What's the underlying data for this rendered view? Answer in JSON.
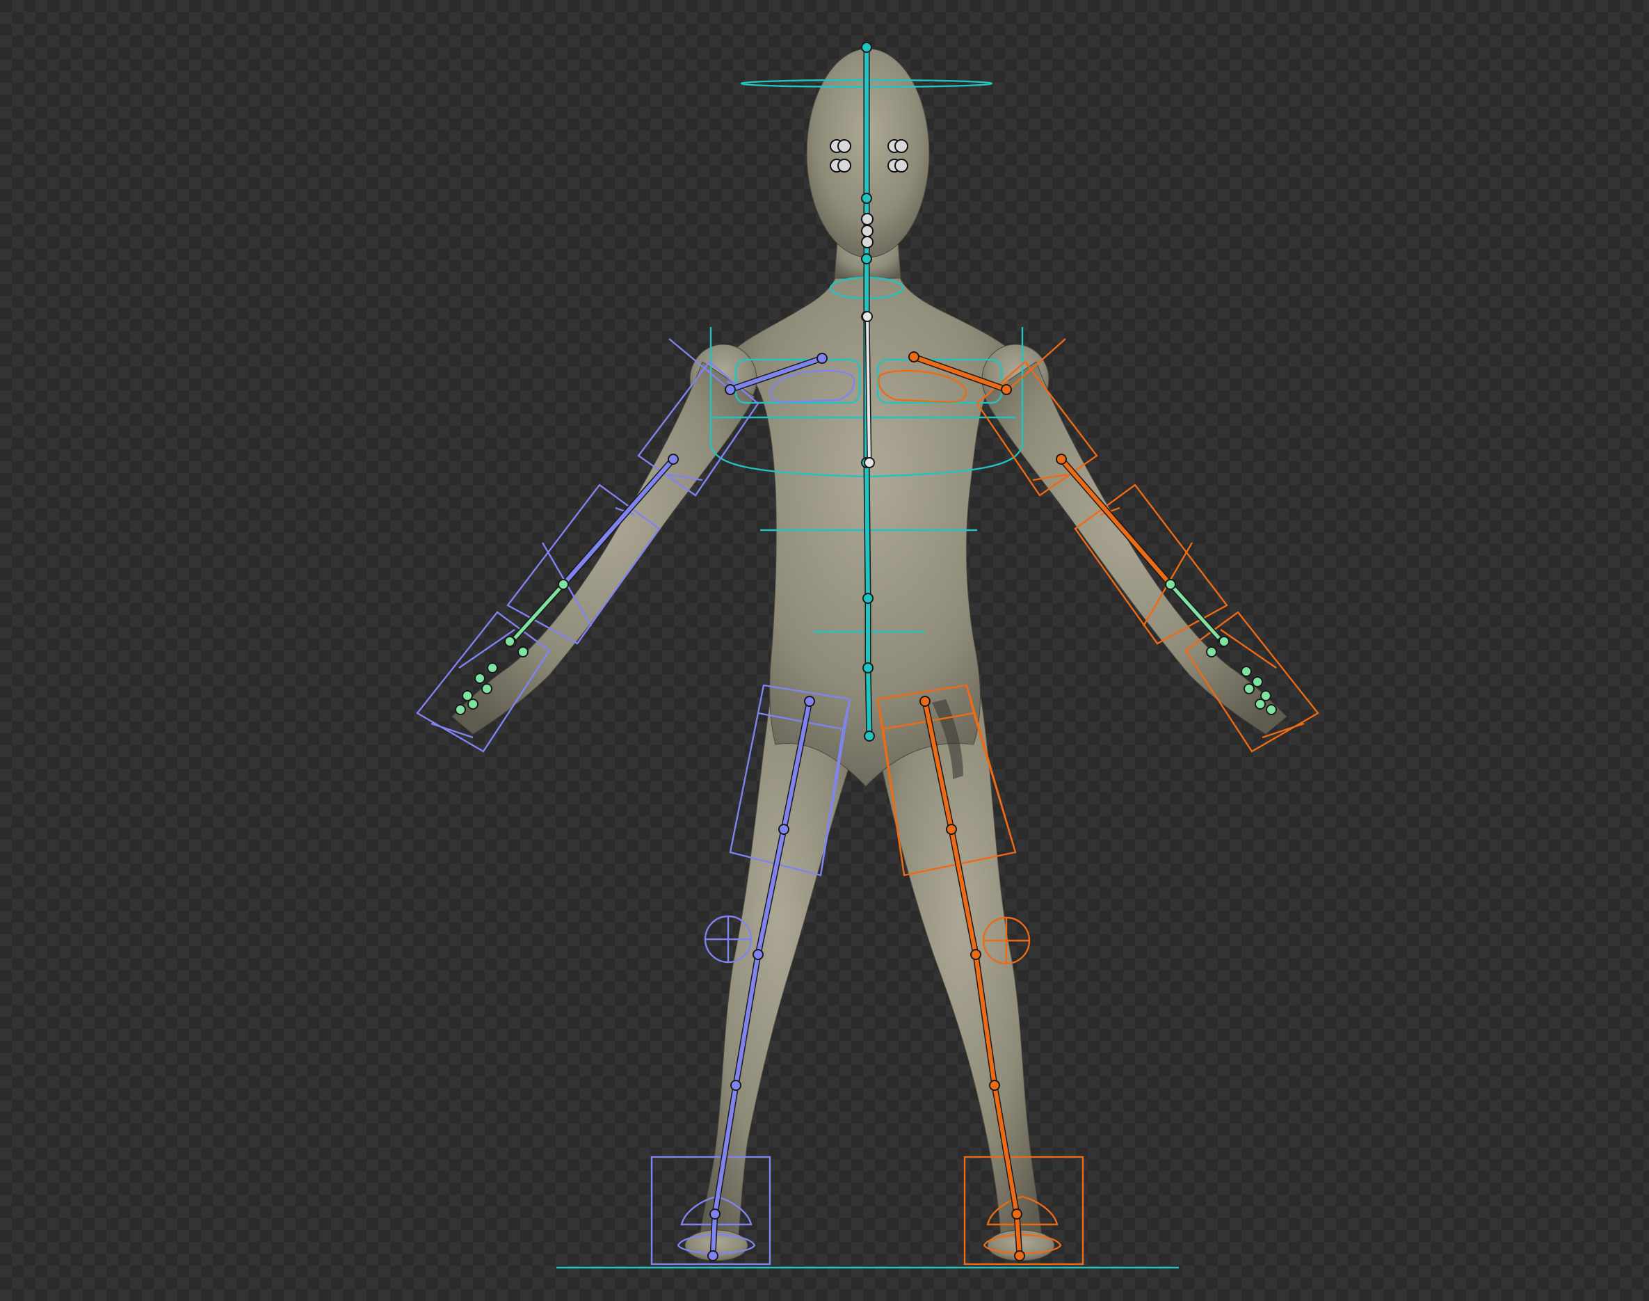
{
  "viewport": {
    "background_colors": [
      "#2b2b2b",
      "#333333"
    ]
  },
  "rig": {
    "mesh_color": "#9e9a88",
    "colors": {
      "center": "#20c4c0",
      "left": "#7f84f0",
      "right": "#ee6a14",
      "finger": "#7fe3a2",
      "deform": "#e6e6e6"
    },
    "bone_chains": [
      {
        "name": "spine-chain",
        "side": "center"
      },
      {
        "name": "left-arm-chain",
        "side": "left"
      },
      {
        "name": "right-arm-chain",
        "side": "right"
      },
      {
        "name": "left-leg-chain",
        "side": "left"
      },
      {
        "name": "right-leg-chain",
        "side": "right"
      }
    ]
  }
}
